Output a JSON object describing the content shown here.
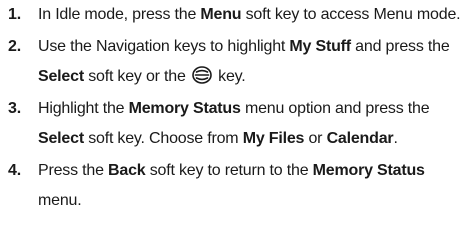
{
  "steps": [
    {
      "number": "1.",
      "parts": {
        "a": "In Idle mode, press the ",
        "b": "Menu",
        "c": " soft key to access Menu mode."
      }
    },
    {
      "number": "2.",
      "parts": {
        "a": "Use the Navigation keys to highlight ",
        "b": "My Stuff",
        "c": " and press the ",
        "d": "Select",
        "e": " soft key or the ",
        "f": " key."
      },
      "icon": "navigation-select-key-icon"
    },
    {
      "number": "3.",
      "parts": {
        "a": "Highlight the ",
        "b": "Memory Status",
        "c": " menu option and press the ",
        "d": "Select",
        "e": " soft key. Choose from ",
        "f": "My Files",
        "g": " or ",
        "h": "Calendar",
        "i": "."
      }
    },
    {
      "number": "4.",
      "parts": {
        "a": "Press the ",
        "b": "Back",
        "c": " soft key to return to the ",
        "d": "Memory Status",
        "e": " menu."
      }
    }
  ]
}
